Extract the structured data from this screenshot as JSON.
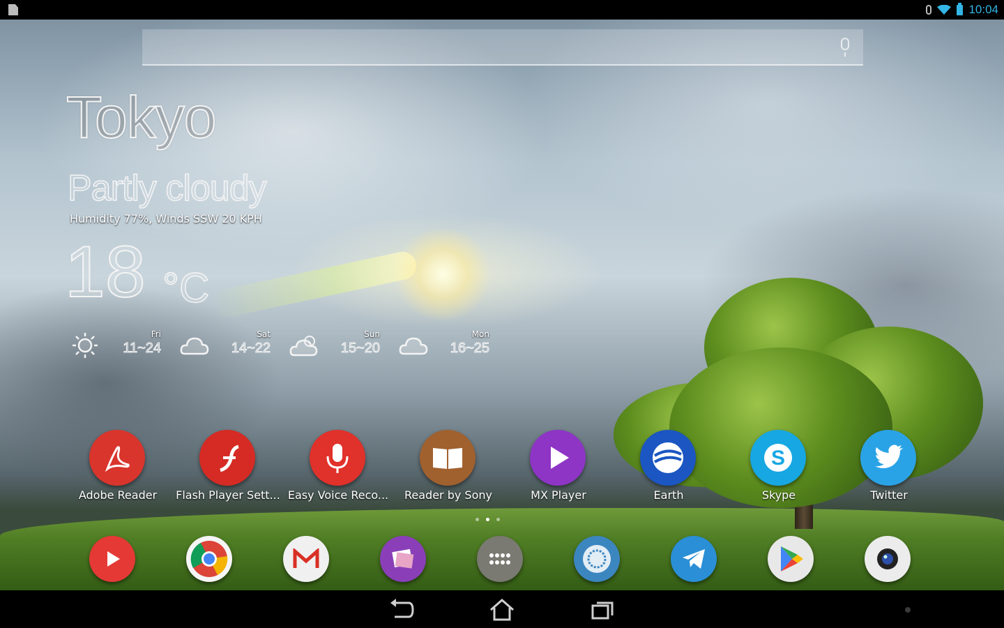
{
  "status_bar": {
    "time": "10:04",
    "icons": [
      "notification-file-icon",
      "bluetooth-icon",
      "wifi-icon",
      "battery-icon"
    ],
    "accent_color": "#33b5e5"
  },
  "search": {
    "placeholder": "",
    "icon": "mic-icon"
  },
  "weather": {
    "city": "Tokyo",
    "condition": "Partly cloudy",
    "details": "Humidity 77%, Winds SSW 20 KPH",
    "temperature": "18",
    "unit": "°C",
    "forecast": [
      {
        "day": "Fri",
        "range": "11~24",
        "icon": "sunny-icon"
      },
      {
        "day": "Sat",
        "range": "14~22",
        "icon": "cloudy-icon"
      },
      {
        "day": "Sun",
        "range": "15~20",
        "icon": "partly-cloudy-icon"
      },
      {
        "day": "Mon",
        "range": "16~25",
        "icon": "cloudy-icon"
      }
    ]
  },
  "apps": [
    {
      "label": "Adobe Reader",
      "icon": "adobe-reader-icon",
      "color": "#d9352c"
    },
    {
      "label": "Flash Player Sett...",
      "icon": "flash-player-icon",
      "color": "#d52b24"
    },
    {
      "label": "Easy Voice Reco...",
      "icon": "voice-recorder-icon",
      "color": "#e0312a"
    },
    {
      "label": "Reader by Sony",
      "icon": "reader-sony-icon",
      "color": "#a0612f"
    },
    {
      "label": "MX Player",
      "icon": "mx-player-icon",
      "color": "#8e35c6"
    },
    {
      "label": "Earth",
      "icon": "google-earth-icon",
      "color": "#1b56c2"
    },
    {
      "label": "Skype",
      "icon": "skype-icon",
      "color": "#17a7e3"
    },
    {
      "label": "Twitter",
      "icon": "twitter-icon",
      "color": "#2aa3e6"
    }
  ],
  "dock": [
    {
      "name": "youtube",
      "icon": "youtube-icon",
      "color": "#e53935"
    },
    {
      "name": "chrome",
      "icon": "chrome-icon",
      "color": "#f5f5f5"
    },
    {
      "name": "gmail",
      "icon": "gmail-icon",
      "color": "#f0f0f0"
    },
    {
      "name": "photo-app",
      "icon": "photo-app-icon",
      "color": "#8a3fb8"
    },
    {
      "name": "app-drawer",
      "icon": "app-drawer-icon",
      "color": "#7a7a72"
    },
    {
      "name": "mosaic-app",
      "icon": "mosaic-app-icon",
      "color": "#3c86c0"
    },
    {
      "name": "telegram",
      "icon": "telegram-icon",
      "color": "#2a8fd6"
    },
    {
      "name": "play-store",
      "icon": "play-store-icon",
      "color": "#e8e8e8"
    },
    {
      "name": "camera",
      "icon": "camera-icon",
      "color": "#ececec"
    }
  ],
  "page_indicator": {
    "pages": 3,
    "current": 2
  },
  "nav": {
    "buttons": [
      "back-icon",
      "home-icon",
      "recents-icon",
      "menu-dot-icon"
    ]
  }
}
